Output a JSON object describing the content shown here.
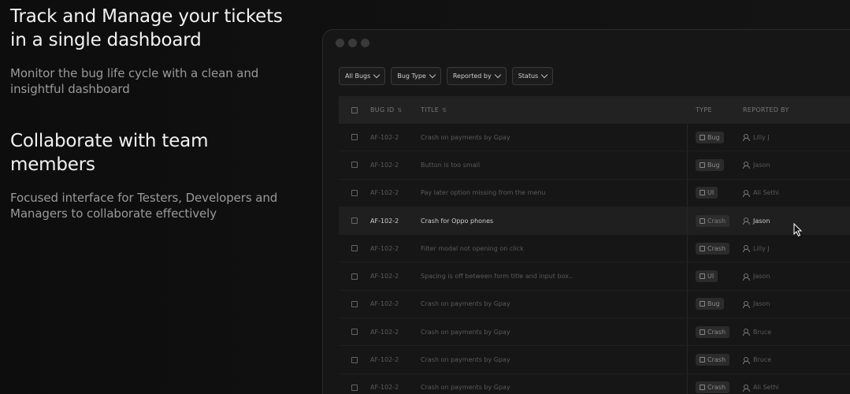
{
  "hero": {
    "title": "Track and Manage your tickets in a single dashboard",
    "subtitle": "Monitor the bug life cycle with a clean and insightful dashboard"
  },
  "collab": {
    "title": "Collaborate with team members",
    "subtitle": "Focused interface for Testers, Developers and Managers  to collaborate effectively"
  },
  "filters": [
    "All Bugs",
    "Bug Type",
    "Reported by",
    "Status"
  ],
  "table": {
    "headers": {
      "bug_id": "BUG ID",
      "title": "TITLE",
      "type": "TYPE",
      "reported_by": "REPORTED BY"
    },
    "rows": [
      {
        "id": "AF-102-2",
        "title": "Crash on payments by Gpay",
        "type": "Bug",
        "type_icon": "bug-icon",
        "reporter": "Lilly J"
      },
      {
        "id": "AF-102-2",
        "title": "Button is too small",
        "type": "Bug",
        "type_icon": "bug-icon",
        "reporter": "Jason"
      },
      {
        "id": "AF-102-2",
        "title": "Pay later option missing from the menu",
        "type": "UI",
        "type_icon": "ui-icon",
        "reporter": "Ali Sethi"
      },
      {
        "id": "AF-102-2",
        "title": "Crash for Oppo phones",
        "type": "Crash",
        "type_icon": "crash-icon",
        "reporter": "Jason",
        "highlighted": true
      },
      {
        "id": "AF-102-2",
        "title": "Filter modal not opening on click",
        "type": "Crash",
        "type_icon": "crash-icon",
        "reporter": "Lilly J"
      },
      {
        "id": "AF-102-2",
        "title": "Spacing is off between form title and input box..",
        "type": "UI",
        "type_icon": "ui-icon",
        "reporter": "Jason"
      },
      {
        "id": "AF-102-2",
        "title": "Crash on payments by Gpay",
        "type": "Bug",
        "type_icon": "bug-icon",
        "reporter": "Jason"
      },
      {
        "id": "AF-102-2",
        "title": "Crash on payments by Gpay",
        "type": "Crash",
        "type_icon": "crash-icon",
        "reporter": "Bruce"
      },
      {
        "id": "AF-102-2",
        "title": "Crash on payments by Gpay",
        "type": "Crash",
        "type_icon": "crash-icon",
        "reporter": "Bruce"
      },
      {
        "id": "AF-102-2",
        "title": "Crash on payments by Gpay",
        "type": "Crash",
        "type_icon": "crash-icon",
        "reporter": "Ali Sethi"
      }
    ]
  }
}
